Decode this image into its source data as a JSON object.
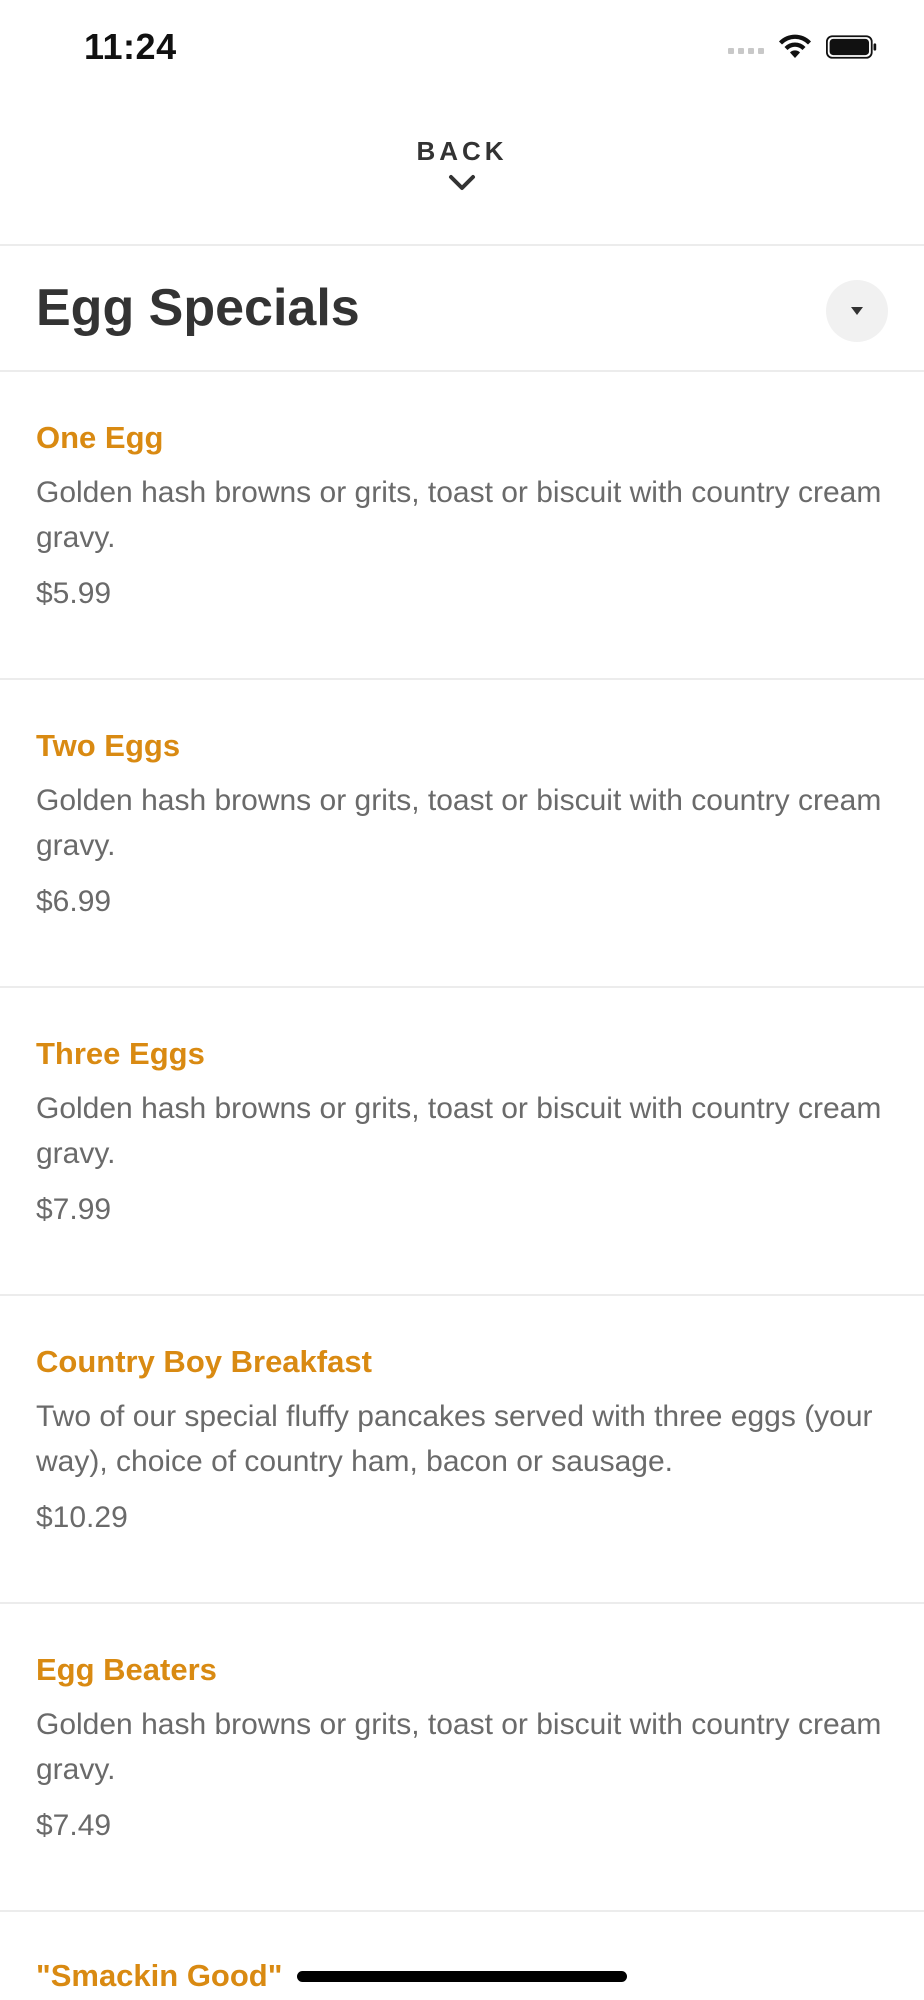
{
  "status_bar": {
    "time": "11:24"
  },
  "header": {
    "back_label": "BACK"
  },
  "section": {
    "title": "Egg Specials"
  },
  "menu_items": [
    {
      "name": "One Egg",
      "description": "Golden hash browns or grits, toast or biscuit with country cream gravy.",
      "price": "$5.99"
    },
    {
      "name": "Two Eggs",
      "description": "Golden hash browns or grits, toast or biscuit with country cream gravy.",
      "price": "$6.99"
    },
    {
      "name": "Three Eggs",
      "description": "Golden hash browns or grits, toast or biscuit with country cream gravy.",
      "price": "$7.99"
    },
    {
      "name": "Country Boy Breakfast",
      "description": "Two of our special fluffy pancakes served with three eggs (your way), choice of country ham, bacon or sausage.",
      "price": "$10.29"
    },
    {
      "name": "Egg Beaters",
      "description": "Golden hash browns or grits, toast or biscuit with country cream gravy.",
      "price": "$7.49"
    }
  ],
  "partial_item": {
    "name": "\"Smackin Good\""
  },
  "colors": {
    "accent": "#d98a12",
    "title_text": "#333333",
    "body_text": "#6a6a6a",
    "divider": "#ececec",
    "button_bg": "#f1f1f1"
  },
  "icons": {
    "signal": "cellular-signal-icon",
    "wifi": "wifi-icon",
    "battery": "battery-icon",
    "back": "chevron-down-icon",
    "collapse": "caret-down-icon"
  }
}
